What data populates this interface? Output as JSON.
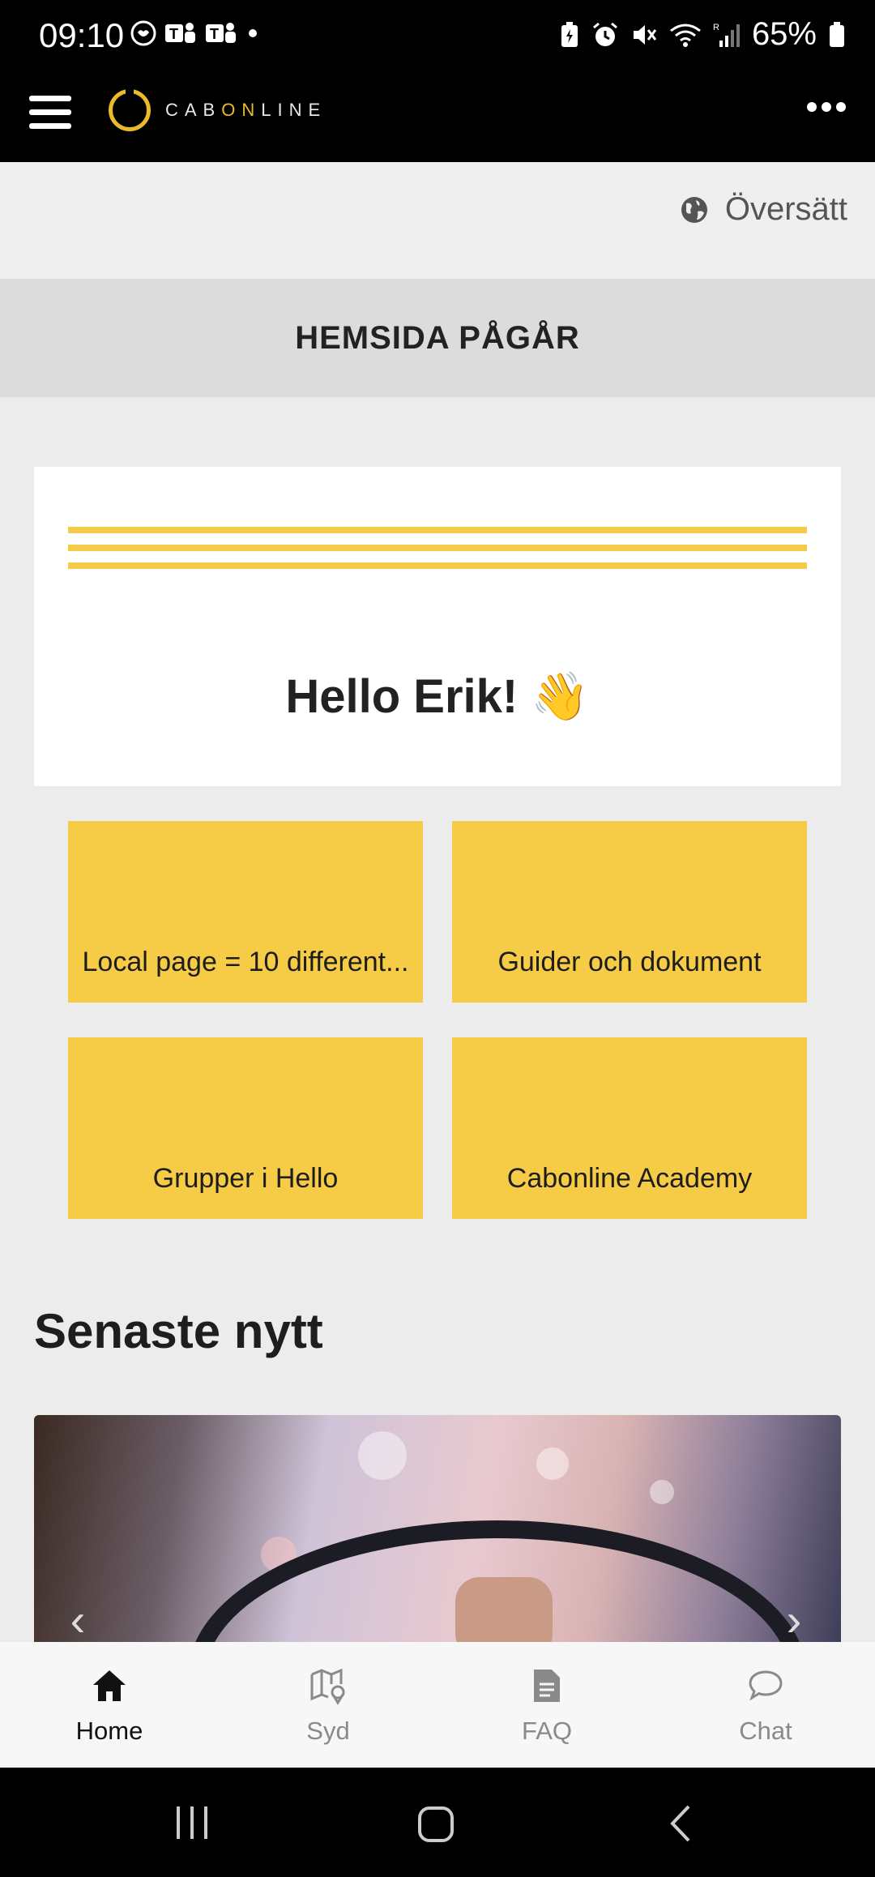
{
  "status_bar": {
    "time": "09:10",
    "battery": "65%",
    "icons": [
      "heart-monitor-icon",
      "teams-icon",
      "teams-icon",
      "dot-icon",
      "battery-saver-icon",
      "alarm-icon",
      "mute-icon",
      "wifi-icon",
      "signal-icon",
      "battery-icon"
    ]
  },
  "app_bar": {
    "logo_text_pre": "CAB",
    "logo_text_on": "ON",
    "logo_text_post": "LINE",
    "brand_color": "#e9bb2a"
  },
  "translate": {
    "label": "Översätt"
  },
  "banner": {
    "text": "HEMSIDA PÅGÅR"
  },
  "hello": {
    "text": "Hello Erik!",
    "emoji": "👋"
  },
  "tiles": [
    {
      "label": "Local page = 10 different..."
    },
    {
      "label": "Guider och dokument"
    },
    {
      "label": "Grupper i Hello"
    },
    {
      "label": "Cabonline Academy"
    }
  ],
  "news": {
    "title": "Senaste nytt"
  },
  "bottom_nav": [
    {
      "label": "Home",
      "icon": "home-icon",
      "active": true
    },
    {
      "label": "Syd",
      "icon": "map-pin-icon",
      "active": false
    },
    {
      "label": "FAQ",
      "icon": "document-icon",
      "active": false
    },
    {
      "label": "Chat",
      "icon": "chat-bubble-icon",
      "active": false
    }
  ],
  "colors": {
    "tile": "#f6cc47",
    "accent_lines": "#f5cc49",
    "background": "#ececec"
  }
}
